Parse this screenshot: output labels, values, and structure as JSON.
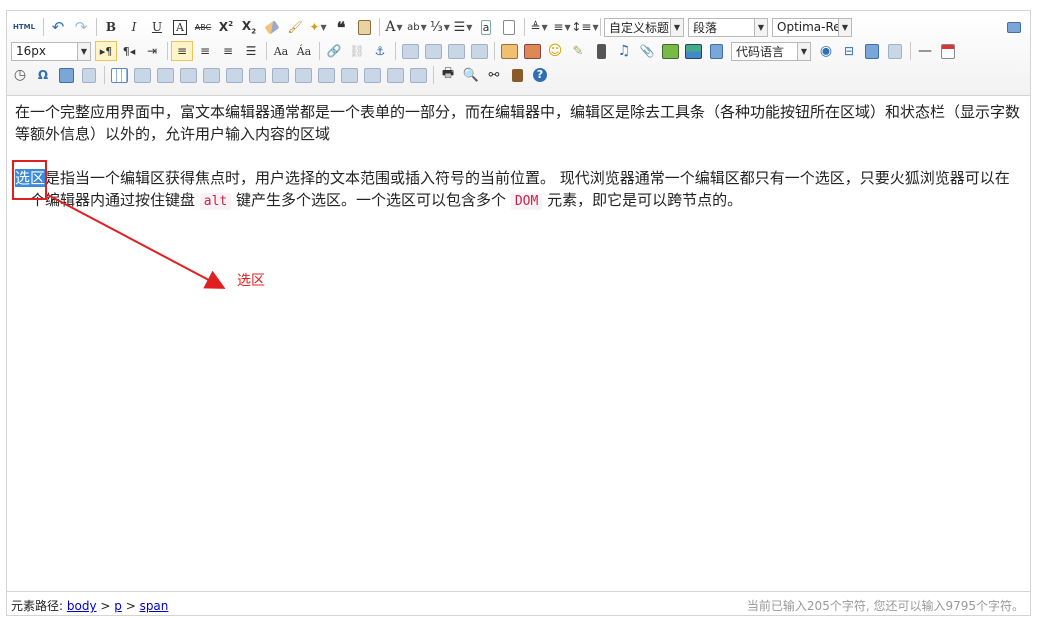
{
  "toolbar": {
    "row1_combos": {
      "heading": "自定义标题",
      "paragraph": "段落",
      "font": "Optima-Re"
    },
    "row2_combos": {
      "fontsize": "16px",
      "codelang": "代码语言"
    },
    "html_label": "HTML"
  },
  "content": {
    "para1": "在一个完整应用界面中，富文本编辑器通常都是一个表单的一部分，而在编辑器中，编辑区是除去工具条（各种功能按钮所在区域）和状态栏（显示字数等额外信息）以外的，允许用户输入内容的区域",
    "para2_sel": "选区",
    "para2_a": "是指当一个编辑区获得焦点时，用户选择的文本范围或插入符号的当前位置。 现代浏览器通常一个编辑区都只有一个选区，只要火狐浏览器可以在一个编辑器内通过按住键盘 ",
    "para2_code1": "alt",
    "para2_b": " 键产生多个选区。一个选区可以包含多个 ",
    "para2_code2": "DOM",
    "para2_c": " 元素，即它是可以跨节点的。"
  },
  "annotation": {
    "label": "选区",
    "color": "#e02020"
  },
  "statusbar": {
    "path_label": "元素路径:",
    "path": [
      "body",
      "p",
      "span"
    ],
    "path_sep": " > ",
    "count": "当前已输入205个字符, 您还可以输入9795个字符。"
  },
  "colors": {
    "accent": "#3b8bdc",
    "selected_bg": "#fff4c8"
  }
}
